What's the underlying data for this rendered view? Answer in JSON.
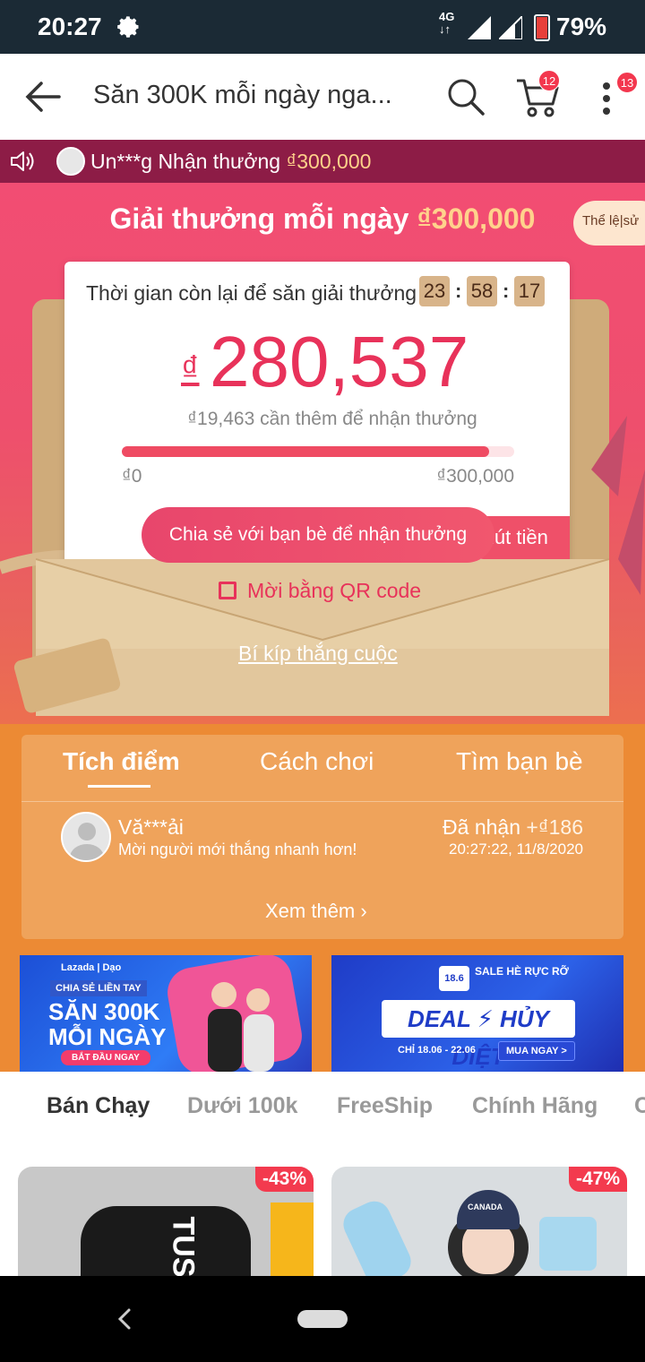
{
  "status_bar": {
    "time": "20:27",
    "network": "4G",
    "battery": "79%",
    "battery_level": 0.79,
    "icons": [
      "gear-icon",
      "signal-icon",
      "battery-icon"
    ]
  },
  "app_bar": {
    "title": "Săn 300K mỗi ngày nga...",
    "cart_badge": "12",
    "more_badge": "13",
    "icons": [
      "back-arrow-icon",
      "search-icon",
      "cart-icon",
      "more-vertical-icon"
    ]
  },
  "marquee": {
    "user": "Un***g",
    "text": "Nhận thưởng",
    "amount": "₫300,000"
  },
  "hero": {
    "heading": "Giải thưởng mỗi ngày",
    "heading_amount": "₫300,000",
    "rules_button": "Thể lệ|sử",
    "timer_label": "Thời gian còn lại để săn giải thưởng",
    "timer": {
      "h": "23",
      "m": "58",
      "s": "17"
    },
    "currency_symbol": "₫",
    "balance": "280,537",
    "withdraw_button": "Rút tiền",
    "need_text": "₫19,463 cần thêm để nhận thưởng",
    "progress": 0.935,
    "progress_min": "₫0",
    "progress_max": "₫300,000",
    "share_button": "Chia sẻ với bạn bè để nhận thưởng",
    "qr_link": "Mời bằng QR code",
    "tips_link": "Bí kíp thắng cuộc"
  },
  "activity": {
    "tabs": [
      "Tích điểm",
      "Cách chơi",
      "Tìm bạn bè"
    ],
    "active_tab": 0,
    "entry": {
      "name": "Vă***ải",
      "message": "Mời người mới thắng nhanh hơn!",
      "received_label": "Đã nhận",
      "received_amount": "+₫186",
      "timestamp": "20:27:22, 11/8/2020"
    },
    "more": "Xem thêm"
  },
  "banners": [
    {
      "brand": "Lazada | Dạo",
      "pill": "CHIA SẺ LIỀN TAY",
      "line1": "SĂN 300K",
      "line2": "MỖI NGÀY",
      "cta": "BẮT ĐẦU NGAY"
    },
    {
      "date_badge": "18.6",
      "sale": "SALE HÈ RỰC RỠ",
      "headline": "DEAL ⚡ HỦY DIỆT",
      "dates": "CHỈ 18.06 - 22.06",
      "cta": "MUA NGAY >"
    }
  ],
  "categories": [
    "Bán Chạy",
    "Dưới 100k",
    "FreeShip",
    "Chính Hãng",
    "C"
  ],
  "active_category": 0,
  "products": [
    {
      "discount": "-43%",
      "print": "TUS"
    },
    {
      "discount": "-47%",
      "print": "CANADA"
    }
  ],
  "colors": {
    "status_bar": "#1b2a35",
    "marquee": "#8d1c46",
    "accent": "#e8325a",
    "orange": "#ec8a34",
    "gold": "#ffd28c"
  }
}
